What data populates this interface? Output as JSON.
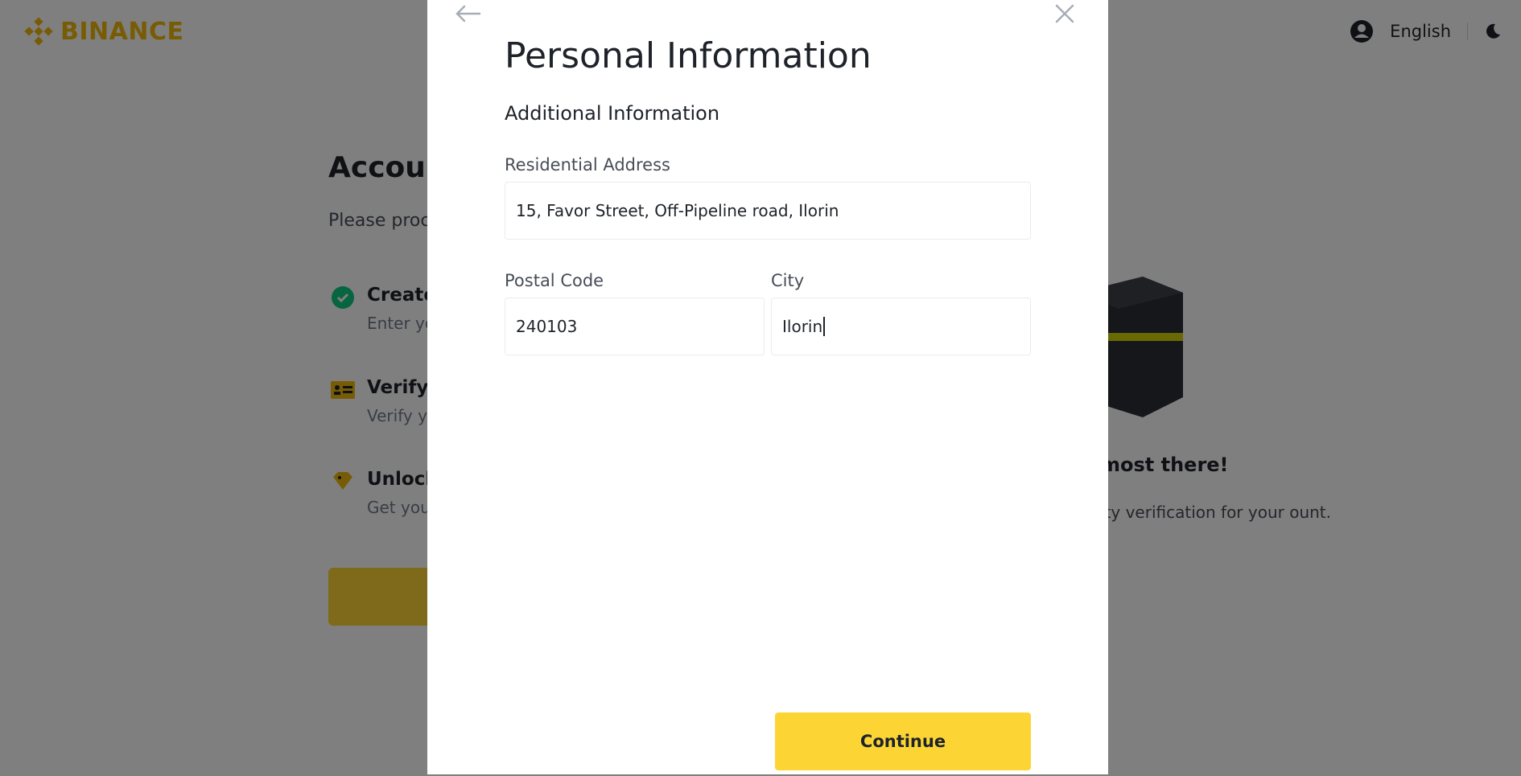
{
  "app": {
    "brand": "BINANCE",
    "brand_color": "#F0B90B",
    "accent_color": "#FCD535"
  },
  "topbar": {
    "language": "English",
    "icons": [
      "user-account-icon",
      "dark-mode-moon-icon"
    ]
  },
  "background": {
    "heading": "Accoun",
    "description": "Please proc",
    "steps": [
      {
        "title": "Create",
        "subtitle": "Enter yo",
        "icon": "check-circle-icon"
      },
      {
        "title": "Verify I",
        "subtitle": "Verify yo",
        "icon": "id-card-icon"
      },
      {
        "title": "Unlock",
        "subtitle": "Get your",
        "icon": "diamond-tag-icon"
      }
    ],
    "promo": {
      "title": "most there!",
      "text": "ity verification for your ount."
    }
  },
  "modal": {
    "title": "Personal Information",
    "section": "Additional Information",
    "address": {
      "label": "Residential Address",
      "value": "15, Favor Street, Off-Pipeline road, Ilorin"
    },
    "postal": {
      "label": "Postal Code",
      "value": "240103"
    },
    "city": {
      "label": "City",
      "value": "Ilorin"
    },
    "continue_label": "Continue"
  }
}
